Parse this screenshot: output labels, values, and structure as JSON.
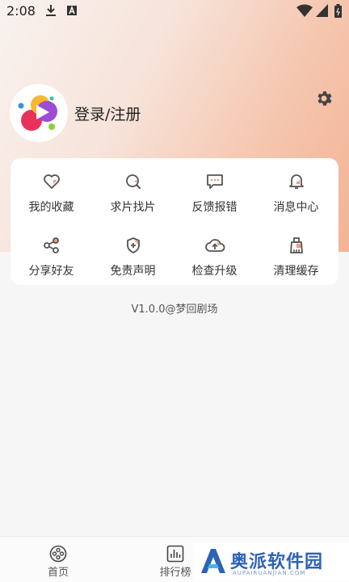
{
  "status_bar": {
    "time": "2:08",
    "icons": [
      "download-icon",
      "a-icon",
      "wifi-icon",
      "signal-icon",
      "battery-icon"
    ]
  },
  "profile": {
    "login_label": "登录/注册",
    "avatar": "app-logo-avatar",
    "settings_icon": "gear-icon"
  },
  "menu": {
    "items": [
      {
        "label": "我的收藏",
        "icon": "heart-icon"
      },
      {
        "label": "求片找片",
        "icon": "search-film-icon"
      },
      {
        "label": "反馈报错",
        "icon": "feedback-icon"
      },
      {
        "label": "消息中心",
        "icon": "bell-icon"
      },
      {
        "label": "分享好友",
        "icon": "share-icon"
      },
      {
        "label": "免责声明",
        "icon": "shield-icon"
      },
      {
        "label": "检查升级",
        "icon": "cloud-upload-icon"
      },
      {
        "label": "清理缓存",
        "icon": "broom-icon"
      }
    ]
  },
  "version": "V1.0.0@梦回剧场",
  "bottom_nav": {
    "items": [
      {
        "label": "首页",
        "icon": "film-reel-icon"
      },
      {
        "label": "排行榜",
        "icon": "chart-icon"
      }
    ]
  },
  "watermark": {
    "text": "奥派软件园",
    "sub": "AUPAIRUANJIAN.COM"
  },
  "colors": {
    "accent": "#f29a7a",
    "icon_stroke": "#555555",
    "hero_gradient_end": "#f4b394"
  }
}
